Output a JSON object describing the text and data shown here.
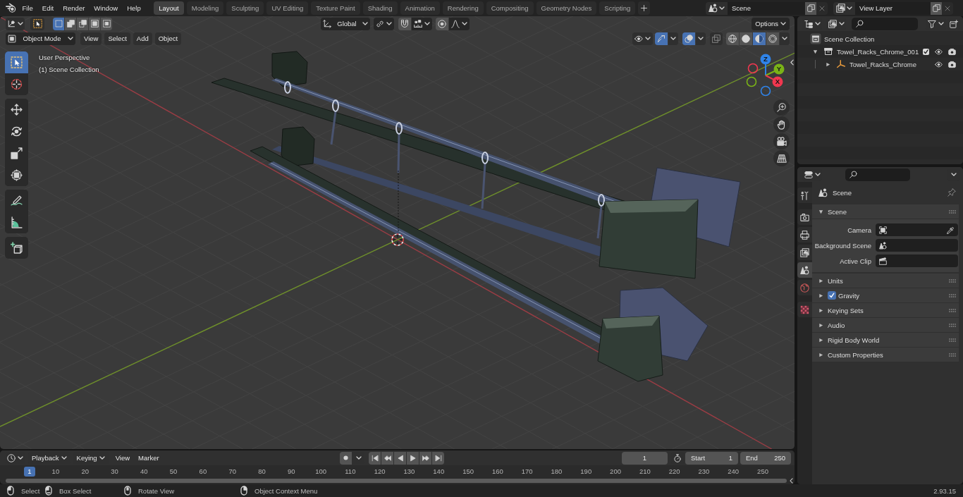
{
  "top_bar": {
    "menus": [
      "File",
      "Edit",
      "Render",
      "Window",
      "Help"
    ],
    "workspaces": [
      {
        "label": "Layout",
        "selected": true
      },
      {
        "label": "Modeling",
        "selected": false
      },
      {
        "label": "Sculpting",
        "selected": false
      },
      {
        "label": "UV Editing",
        "selected": false
      },
      {
        "label": "Texture Paint",
        "selected": false
      },
      {
        "label": "Shading",
        "selected": false
      },
      {
        "label": "Animation",
        "selected": false
      },
      {
        "label": "Rendering",
        "selected": false
      },
      {
        "label": "Compositing",
        "selected": false
      },
      {
        "label": "Geometry Nodes",
        "selected": false
      },
      {
        "label": "Scripting",
        "selected": false
      }
    ],
    "scene": "Scene",
    "view_layer": "View Layer"
  },
  "viewport": {
    "header": {
      "select_modes": [
        {
          "selected": true
        },
        {
          "selected": false
        },
        {
          "selected": false
        },
        {
          "selected": false
        },
        {
          "selected": false
        }
      ],
      "orientation": "Global",
      "options": "Options",
      "mode": "Object Mode",
      "menus": [
        "View",
        "Select",
        "Add",
        "Object"
      ],
      "gizmos": true,
      "overlays": true,
      "xray": false,
      "shading": [
        {
          "selected": false
        },
        {
          "selected": false
        },
        {
          "selected": true
        },
        {
          "selected": false
        }
      ]
    },
    "tool_groups": [
      [
        {
          "selected": true
        },
        {
          "selected": false
        }
      ],
      [
        {
          "selected": false
        },
        {
          "selected": false
        },
        {
          "selected": false
        },
        {
          "selected": false
        }
      ],
      [
        {
          "selected": false
        },
        {
          "selected": false
        }
      ],
      [
        {
          "selected": false
        }
      ]
    ],
    "view_name": "User Perspective",
    "collection_label": "(1) Scene Collection",
    "gizmo_axes": [
      {
        "label": "Z",
        "color": "#2f83e8"
      },
      {
        "label": "Y",
        "color": "#7ab317"
      },
      {
        "label": "X",
        "color": "#f0374f"
      }
    ]
  },
  "timeline": {
    "menus": [
      {
        "label": "Playback",
        "kind": "dropdown"
      },
      {
        "label": "Keying",
        "kind": "dropdown"
      },
      {
        "label": "View",
        "kind": "plain"
      },
      {
        "label": "Marker",
        "kind": "plain"
      }
    ],
    "current_frame": "1",
    "start": {
      "label": "Start",
      "value": "1"
    },
    "end": {
      "label": "End",
      "value": "250"
    },
    "ruler": {
      "current": "1",
      "marks": [
        "10",
        "20",
        "30",
        "40",
        "50",
        "60",
        "70",
        "80",
        "90",
        "100",
        "110",
        "120",
        "130",
        "140",
        "150",
        "160",
        "170",
        "180",
        "190",
        "200",
        "210",
        "220",
        "230",
        "240",
        "250"
      ]
    }
  },
  "outliner": {
    "tree": [
      {
        "label": "Scene Collection",
        "kind": "root",
        "children": [
          {
            "label": "Towel_Racks_Chrome_001",
            "kind": "collection",
            "expanded": true,
            "checked": true,
            "children": [
              {
                "label": "Towel_Racks_Chrome",
                "kind": "empty",
                "expanded": false
              }
            ]
          }
        ]
      }
    ]
  },
  "properties": {
    "tab_groups": [
      [
        {
          "selected": false
        }
      ],
      [
        {
          "selected": false
        },
        {
          "selected": false
        },
        {
          "selected": false
        },
        {
          "selected": true
        },
        {
          "selected": false
        }
      ],
      [
        {
          "selected": false
        }
      ]
    ],
    "context": "Scene",
    "panels": [
      {
        "label": "Scene",
        "expanded": true,
        "fields": [
          {
            "label": "Camera",
            "kind": "camera"
          },
          {
            "label": "Background Scene",
            "kind": "scene"
          },
          {
            "label": "Active Clip",
            "kind": "clip"
          }
        ]
      },
      {
        "label": "Units",
        "expanded": false
      },
      {
        "label": "Gravity",
        "expanded": false,
        "checked": true
      },
      {
        "label": "Keying Sets",
        "expanded": false
      },
      {
        "label": "Audio",
        "expanded": false
      },
      {
        "label": "Rigid Body World",
        "expanded": false
      },
      {
        "label": "Custom Properties",
        "expanded": false
      }
    ]
  },
  "status_bar": {
    "hints": [
      {
        "text": "Select",
        "kind": "left-click"
      },
      {
        "text": "Box Select",
        "kind": "left-drag"
      },
      {
        "text": "Rotate View",
        "kind": "middle-click"
      },
      {
        "text": "Object Context Menu",
        "kind": "right-click"
      }
    ],
    "version": "2.93.15"
  }
}
